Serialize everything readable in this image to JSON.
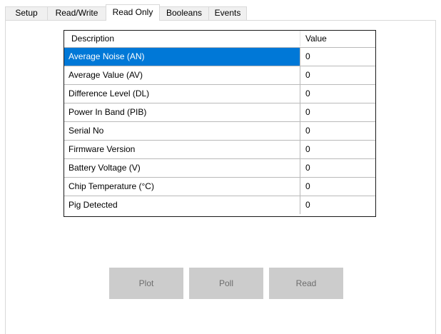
{
  "tabs": [
    {
      "label": "Setup",
      "active": false
    },
    {
      "label": "Read/Write",
      "active": false
    },
    {
      "label": "Read Only",
      "active": true
    },
    {
      "label": "Booleans",
      "active": false
    },
    {
      "label": "Events",
      "active": false
    }
  ],
  "grid": {
    "columns": {
      "description": "Description",
      "value": "Value"
    },
    "selected_row": 0,
    "rows": [
      {
        "description": "Average Noise (AN)",
        "value": "0"
      },
      {
        "description": "Average Value (AV)",
        "value": "0"
      },
      {
        "description": "Difference Level (DL)",
        "value": "0"
      },
      {
        "description": "Power In Band (PIB)",
        "value": "0"
      },
      {
        "description": "Serial No",
        "value": "0"
      },
      {
        "description": "Firmware Version",
        "value": "0"
      },
      {
        "description": "Battery Voltage (V)",
        "value": "0"
      },
      {
        "description": "Chip Temperature (°C)",
        "value": "0"
      },
      {
        "description": "Pig Detected",
        "value": "0"
      }
    ]
  },
  "buttons": {
    "plot_label": "Plot",
    "poll_label": "Poll",
    "read_label": "Read",
    "enabled": false
  },
  "colors": {
    "selection": "#0078d7",
    "button_disabled_bg": "#cccccc",
    "button_disabled_text": "#6d6d6d"
  }
}
